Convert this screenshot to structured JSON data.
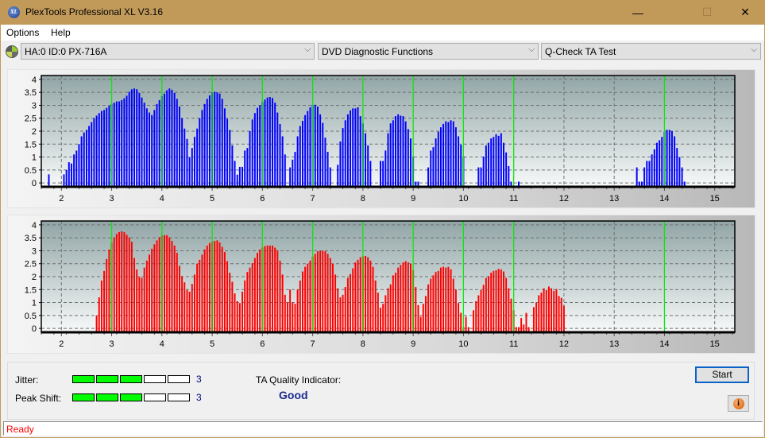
{
  "window": {
    "title": "PlexTools Professional XL V3.16",
    "app_icon_text": "XL",
    "minimize": "—",
    "maximize": "☐",
    "close": "✕"
  },
  "menu": {
    "items": [
      "Options",
      "Help"
    ]
  },
  "toolbar": {
    "drive": "HA:0 ID:0  PX-716A",
    "function": "DVD Diagnostic Functions",
    "test": "Q-Check TA Test",
    "chevron": "⌵"
  },
  "colors": {
    "blue_bars": "#0000ff",
    "red_bars": "#ff0000",
    "marker_lines": "#00ff00",
    "meter_on": "#00ff00",
    "quality_text": "#1c2a8c",
    "status_text": "#ff0000"
  },
  "chart_data": [
    {
      "type": "bar",
      "name": "blue-histogram",
      "title": "",
      "xlabel": "",
      "ylabel": "",
      "xlim": [
        1.6,
        15.4
      ],
      "ylim": [
        -0.15,
        4.15
      ],
      "xticks": [
        "2",
        "3",
        "4",
        "5",
        "6",
        "7",
        "8",
        "9",
        "10",
        "11",
        "12",
        "13",
        "14",
        "15"
      ],
      "yticks": [
        "0",
        "0.5",
        "1",
        "1.5",
        "2",
        "2.5",
        "3",
        "3.5",
        "4"
      ],
      "grid": true,
      "marker_lines_x": [
        3,
        4,
        5,
        6,
        7,
        8,
        9,
        10,
        11,
        14
      ],
      "color": "#0000ff",
      "x_start": 1.75,
      "x_step": 0.05,
      "values": [
        0.33,
        0,
        0,
        0,
        0,
        0.0,
        0.33,
        0.5,
        0.8,
        0.75,
        1.1,
        1.25,
        1.5,
        1.8,
        1.95,
        2.05,
        2.2,
        2.35,
        2.5,
        2.6,
        2.7,
        2.78,
        2.82,
        2.9,
        2.98,
        3.05,
        3.1,
        3.15,
        3.15,
        3.2,
        3.27,
        3.37,
        3.52,
        3.62,
        3.65,
        3.62,
        3.48,
        3.3,
        3.1,
        2.88,
        2.72,
        2.62,
        2.82,
        3.05,
        3.2,
        3.35,
        3.45,
        3.58,
        3.65,
        3.6,
        3.48,
        3.25,
        2.95,
        2.5,
        2.1,
        1.7,
        1.0,
        1.35,
        1.78,
        2.1,
        2.5,
        2.82,
        3.05,
        3.25,
        3.38,
        3.5,
        3.52,
        3.5,
        3.45,
        3.25,
        2.88,
        2.48,
        2.05,
        1.45,
        0.85,
        0.32,
        0.62,
        0.62,
        1.25,
        1.35,
        2.0,
        2.45,
        2.7,
        2.9,
        3.0,
        3.12,
        3.22,
        3.3,
        3.32,
        3.28,
        3.1,
        2.72,
        2.28,
        1.8,
        1.1,
        0,
        0.6,
        0.9,
        1.2,
        1.8,
        2.2,
        2.4,
        2.62,
        2.78,
        2.92,
        3.02,
        3.02,
        2.95,
        2.65,
        2.32,
        1.75,
        1.2,
        0.6,
        0.0,
        0.0,
        0.7,
        1.6,
        2.12,
        2.42,
        2.65,
        2.8,
        2.88,
        2.88,
        2.92,
        2.58,
        2.3,
        1.92,
        1.45,
        0.85,
        0,
        0,
        0,
        0.85,
        0.85,
        1.25,
        1.92,
        2.3,
        2.42,
        2.58,
        2.65,
        2.6,
        2.58,
        2.38,
        2.08,
        1.72,
        1.02,
        0.05,
        0.05,
        0,
        0,
        0,
        0.6,
        1.25,
        1.38,
        1.72,
        1.98,
        2.15,
        2.28,
        2.38,
        2.35,
        2.42,
        2.38,
        2.15,
        1.8,
        1.48,
        1.02,
        0,
        0,
        0,
        0,
        0,
        0.6,
        0.6,
        1.02,
        1.45,
        1.55,
        1.72,
        1.78,
        1.88,
        1.82,
        1.92,
        1.55,
        1.18,
        0.65,
        0.05,
        0,
        0,
        0.05,
        0,
        0,
        0,
        0,
        0,
        0,
        0,
        0,
        0,
        0,
        0,
        0,
        0,
        0,
        0,
        0,
        0,
        0,
        0,
        0,
        0,
        0,
        0,
        0,
        0,
        0,
        0,
        0,
        0,
        0,
        0,
        0,
        0,
        0,
        0,
        0,
        0,
        0,
        0,
        0,
        0,
        0,
        0,
        0,
        0,
        0,
        0.6,
        0.05,
        0.05,
        0.6,
        0.85,
        0.85,
        1.1,
        1.3,
        1.55,
        1.65,
        1.78,
        1.98,
        2.05,
        2.05,
        2.0,
        1.8,
        1.35,
        1.0,
        0.6,
        0.05
      ]
    },
    {
      "type": "bar",
      "name": "red-histogram",
      "title": "",
      "xlabel": "",
      "ylabel": "",
      "xlim": [
        1.6,
        15.4
      ],
      "ylim": [
        -0.15,
        4.15
      ],
      "xticks": [
        "2",
        "3",
        "4",
        "5",
        "6",
        "7",
        "8",
        "9",
        "10",
        "11",
        "12",
        "13",
        "14",
        "15"
      ],
      "yticks": [
        "0",
        "0.5",
        "1",
        "1.5",
        "2",
        "2.5",
        "3",
        "3.5",
        "4"
      ],
      "grid": true,
      "marker_lines_x": [
        3,
        4,
        5,
        6,
        7,
        8,
        9,
        10,
        11,
        14
      ],
      "color": "#ff0000",
      "x_start": 2.7,
      "x_step": 0.05,
      "values": [
        0.5,
        1.2,
        1.85,
        2.22,
        2.68,
        3.05,
        3.32,
        3.52,
        3.65,
        3.72,
        3.75,
        3.72,
        3.62,
        3.52,
        3.35,
        2.72,
        2.28,
        2.0,
        1.95,
        2.35,
        2.62,
        2.85,
        3.08,
        3.25,
        3.4,
        3.52,
        3.58,
        3.6,
        3.6,
        3.52,
        3.38,
        3.2,
        2.92,
        2.42,
        2.02,
        1.78,
        1.48,
        1.42,
        1.72,
        2.08,
        2.5,
        2.65,
        2.85,
        3.05,
        3.2,
        3.3,
        3.35,
        3.38,
        3.4,
        3.32,
        3.15,
        2.95,
        2.6,
        2.15,
        1.8,
        1.35,
        1.05,
        0.98,
        1.42,
        1.85,
        2.18,
        2.35,
        2.52,
        2.72,
        2.92,
        3.05,
        3.12,
        3.18,
        3.2,
        3.2,
        3.2,
        3.12,
        3.02,
        2.62,
        2.08,
        1.3,
        1.0,
        1.5,
        1.0,
        0.95,
        1.5,
        1.85,
        2.2,
        2.38,
        2.5,
        2.62,
        2.78,
        2.88,
        2.98,
        3.0,
        3.0,
        2.98,
        2.88,
        2.72,
        2.5,
        2.08,
        1.55,
        1.2,
        1.3,
        1.6,
        1.95,
        2.1,
        2.32,
        2.55,
        2.65,
        2.75,
        2.78,
        2.8,
        2.75,
        2.62,
        2.38,
        1.85,
        1.38,
        0.8,
        0.95,
        1.28,
        1.55,
        1.7,
        2.05,
        2.15,
        2.35,
        2.45,
        2.55,
        2.6,
        2.55,
        2.5,
        2.25,
        1.6,
        0.9,
        0.45,
        0.95,
        1.25,
        1.7,
        1.92,
        2.05,
        2.18,
        2.22,
        2.35,
        2.38,
        2.35,
        2.38,
        2.28,
        1.92,
        1.5,
        0.98,
        0.6,
        0.05,
        0.45,
        0.05,
        0,
        0.7,
        1.05,
        1.28,
        1.48,
        1.68,
        1.95,
        2.02,
        2.15,
        2.22,
        2.25,
        2.3,
        2.28,
        2.2,
        1.95,
        1.55,
        1.15,
        0.7,
        0.05,
        0.05,
        0.4,
        0.15,
        0.6,
        0.05,
        0.0,
        0.82,
        1.0,
        1.28,
        1.38,
        1.55,
        1.48,
        1.62,
        1.55,
        1.45,
        1.52,
        1.25,
        1.18,
        0.88
      ]
    }
  ],
  "meters": {
    "jitter": {
      "label": "Jitter:",
      "value": "3",
      "level": 3,
      "max": 5
    },
    "peak_shift": {
      "label": "Peak Shift:",
      "value": "3",
      "level": 3,
      "max": 5
    }
  },
  "quality": {
    "label": "TA Quality Indicator:",
    "value": "Good"
  },
  "buttons": {
    "start": "Start",
    "info": "i"
  },
  "status": {
    "text": "Ready"
  }
}
